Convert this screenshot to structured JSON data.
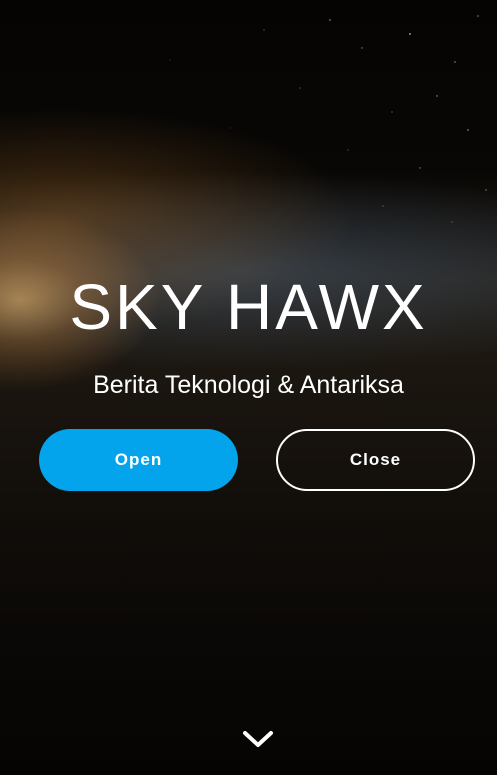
{
  "hero": {
    "title": "SKY HAWX",
    "subtitle": "Berita Teknologi & Antariksa",
    "open_label": "Open",
    "close_label": "Close",
    "scroll_icon": "chevron-down-icon"
  },
  "colors": {
    "accent": "#03a4ec",
    "text": "#ffffff"
  }
}
